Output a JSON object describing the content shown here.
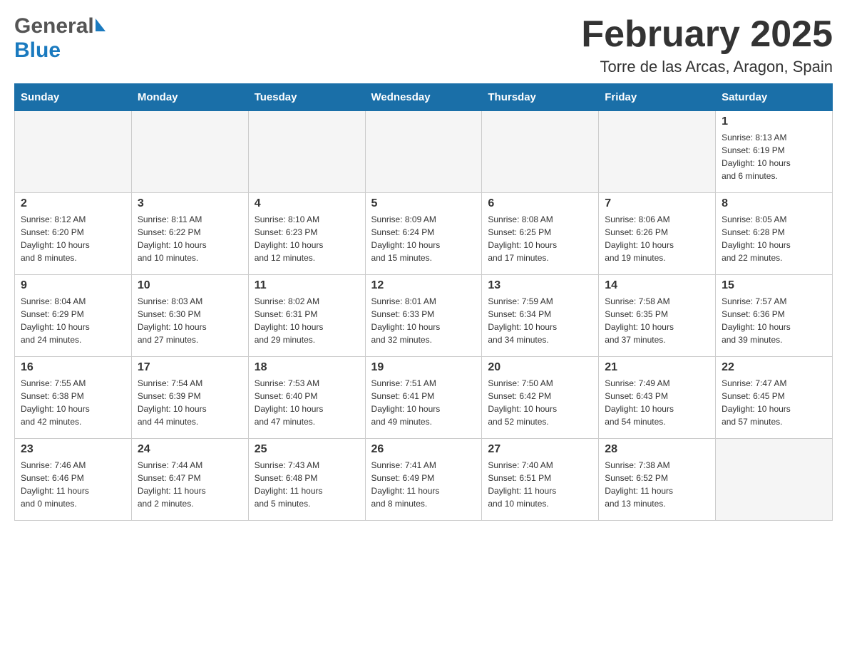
{
  "header": {
    "title": "February 2025",
    "location": "Torre de las Arcas, Aragon, Spain",
    "logo_general": "General",
    "logo_blue": "Blue"
  },
  "weekdays": [
    "Sunday",
    "Monday",
    "Tuesday",
    "Wednesday",
    "Thursday",
    "Friday",
    "Saturday"
  ],
  "weeks": [
    [
      {
        "day": "",
        "info": ""
      },
      {
        "day": "",
        "info": ""
      },
      {
        "day": "",
        "info": ""
      },
      {
        "day": "",
        "info": ""
      },
      {
        "day": "",
        "info": ""
      },
      {
        "day": "",
        "info": ""
      },
      {
        "day": "1",
        "info": "Sunrise: 8:13 AM\nSunset: 6:19 PM\nDaylight: 10 hours\nand 6 minutes."
      }
    ],
    [
      {
        "day": "2",
        "info": "Sunrise: 8:12 AM\nSunset: 6:20 PM\nDaylight: 10 hours\nand 8 minutes."
      },
      {
        "day": "3",
        "info": "Sunrise: 8:11 AM\nSunset: 6:22 PM\nDaylight: 10 hours\nand 10 minutes."
      },
      {
        "day": "4",
        "info": "Sunrise: 8:10 AM\nSunset: 6:23 PM\nDaylight: 10 hours\nand 12 minutes."
      },
      {
        "day": "5",
        "info": "Sunrise: 8:09 AM\nSunset: 6:24 PM\nDaylight: 10 hours\nand 15 minutes."
      },
      {
        "day": "6",
        "info": "Sunrise: 8:08 AM\nSunset: 6:25 PM\nDaylight: 10 hours\nand 17 minutes."
      },
      {
        "day": "7",
        "info": "Sunrise: 8:06 AM\nSunset: 6:26 PM\nDaylight: 10 hours\nand 19 minutes."
      },
      {
        "day": "8",
        "info": "Sunrise: 8:05 AM\nSunset: 6:28 PM\nDaylight: 10 hours\nand 22 minutes."
      }
    ],
    [
      {
        "day": "9",
        "info": "Sunrise: 8:04 AM\nSunset: 6:29 PM\nDaylight: 10 hours\nand 24 minutes."
      },
      {
        "day": "10",
        "info": "Sunrise: 8:03 AM\nSunset: 6:30 PM\nDaylight: 10 hours\nand 27 minutes."
      },
      {
        "day": "11",
        "info": "Sunrise: 8:02 AM\nSunset: 6:31 PM\nDaylight: 10 hours\nand 29 minutes."
      },
      {
        "day": "12",
        "info": "Sunrise: 8:01 AM\nSunset: 6:33 PM\nDaylight: 10 hours\nand 32 minutes."
      },
      {
        "day": "13",
        "info": "Sunrise: 7:59 AM\nSunset: 6:34 PM\nDaylight: 10 hours\nand 34 minutes."
      },
      {
        "day": "14",
        "info": "Sunrise: 7:58 AM\nSunset: 6:35 PM\nDaylight: 10 hours\nand 37 minutes."
      },
      {
        "day": "15",
        "info": "Sunrise: 7:57 AM\nSunset: 6:36 PM\nDaylight: 10 hours\nand 39 minutes."
      }
    ],
    [
      {
        "day": "16",
        "info": "Sunrise: 7:55 AM\nSunset: 6:38 PM\nDaylight: 10 hours\nand 42 minutes."
      },
      {
        "day": "17",
        "info": "Sunrise: 7:54 AM\nSunset: 6:39 PM\nDaylight: 10 hours\nand 44 minutes."
      },
      {
        "day": "18",
        "info": "Sunrise: 7:53 AM\nSunset: 6:40 PM\nDaylight: 10 hours\nand 47 minutes."
      },
      {
        "day": "19",
        "info": "Sunrise: 7:51 AM\nSunset: 6:41 PM\nDaylight: 10 hours\nand 49 minutes."
      },
      {
        "day": "20",
        "info": "Sunrise: 7:50 AM\nSunset: 6:42 PM\nDaylight: 10 hours\nand 52 minutes."
      },
      {
        "day": "21",
        "info": "Sunrise: 7:49 AM\nSunset: 6:43 PM\nDaylight: 10 hours\nand 54 minutes."
      },
      {
        "day": "22",
        "info": "Sunrise: 7:47 AM\nSunset: 6:45 PM\nDaylight: 10 hours\nand 57 minutes."
      }
    ],
    [
      {
        "day": "23",
        "info": "Sunrise: 7:46 AM\nSunset: 6:46 PM\nDaylight: 11 hours\nand 0 minutes."
      },
      {
        "day": "24",
        "info": "Sunrise: 7:44 AM\nSunset: 6:47 PM\nDaylight: 11 hours\nand 2 minutes."
      },
      {
        "day": "25",
        "info": "Sunrise: 7:43 AM\nSunset: 6:48 PM\nDaylight: 11 hours\nand 5 minutes."
      },
      {
        "day": "26",
        "info": "Sunrise: 7:41 AM\nSunset: 6:49 PM\nDaylight: 11 hours\nand 8 minutes."
      },
      {
        "day": "27",
        "info": "Sunrise: 7:40 AM\nSunset: 6:51 PM\nDaylight: 11 hours\nand 10 minutes."
      },
      {
        "day": "28",
        "info": "Sunrise: 7:38 AM\nSunset: 6:52 PM\nDaylight: 11 hours\nand 13 minutes."
      },
      {
        "day": "",
        "info": ""
      }
    ]
  ]
}
